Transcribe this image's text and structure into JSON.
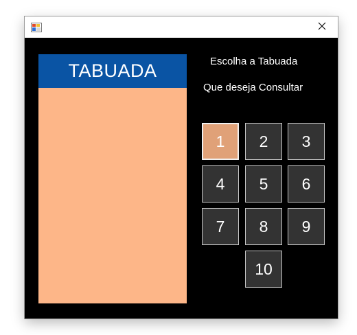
{
  "window": {
    "title": "",
    "close_glyph": "✕"
  },
  "panel": {
    "header": "TABUADA",
    "bg_color": "#fdb688",
    "header_color": "#0a54a4"
  },
  "labels": {
    "line1": "Escolha a Tabuada",
    "line2": "Que deseja Consultar"
  },
  "buttons": [
    {
      "label": "1",
      "selected": true
    },
    {
      "label": "2",
      "selected": false
    },
    {
      "label": "3",
      "selected": false
    },
    {
      "label": "4",
      "selected": false
    },
    {
      "label": "5",
      "selected": false
    },
    {
      "label": "6",
      "selected": false
    },
    {
      "label": "7",
      "selected": false
    },
    {
      "label": "8",
      "selected": false
    },
    {
      "label": "9",
      "selected": false
    },
    {
      "label": "10",
      "selected": false
    }
  ]
}
